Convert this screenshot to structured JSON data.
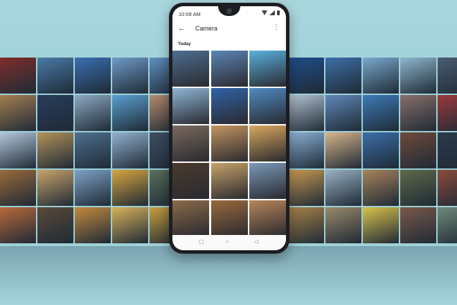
{
  "status_bar": {
    "time": "10:08 AM"
  },
  "app_bar": {
    "back_icon": "back-arrow-icon",
    "title": "Camera",
    "more_icon": "more-vert-icon"
  },
  "section_label": "Today",
  "nav_bar": {
    "recent": "▢",
    "home": "○",
    "back": "◁"
  },
  "icons": {
    "back": "←",
    "more": "⋮"
  },
  "photos": [
    "#4d6e90",
    "#5b85b5",
    "#5ab0dd",
    "#8fb6d8",
    "#2f63a8",
    "#4e8bc4",
    "#7a6a5e",
    "#c49560",
    "#d9a85d",
    "#4a3a2d",
    "#c7a36a",
    "#7a9ab8",
    "#8a6a4a",
    "#9a6a3a",
    "#b7855a"
  ],
  "wall_colors": [
    "#7f2d2a",
    "#4a7ba8",
    "#3a6fb0",
    "#6f9bc8",
    "#5f8fc0",
    "#2e3a5c",
    "#1e4f8c",
    "#3e6fa8",
    "#7aa9cf",
    "#8fb8d0",
    "#4b5d72",
    "#a0c4dc",
    "#a67f52",
    "#283c5c",
    "#8da9c4",
    "#5aa0d0",
    "#b48a6e",
    "#3a5f8c",
    "#b6c4d4",
    "#5f88b8",
    "#3d7bb8",
    "#8a6f6a",
    "#9a3a3a",
    "#cc8a70",
    "#b3c8dc",
    "#b4925a",
    "#4f6f90",
    "#93b2cf",
    "#3f4f62",
    "#6b6e74",
    "#8bb3d8",
    "#d7b48a",
    "#3a6fa8",
    "#6f4a3a",
    "#2c3a4c",
    "#7ab8d8",
    "#9a6a3a",
    "#c9a36a",
    "#7fa2c8",
    "#d9a63e",
    "#5a6f5a",
    "#4a4d52",
    "#c99a52",
    "#9ab2c4",
    "#a8835a",
    "#5f6a4a",
    "#8b4a3a",
    "#bda56a",
    "#b96a3a",
    "#5a4a3a",
    "#c48a3e",
    "#d8b25a",
    "#c89e3e",
    "#6b6e4a",
    "#a88448",
    "#9a8a6a",
    "#d9c24a",
    "#7a5a4a",
    "#6f8a7a",
    "#c49a62"
  ]
}
